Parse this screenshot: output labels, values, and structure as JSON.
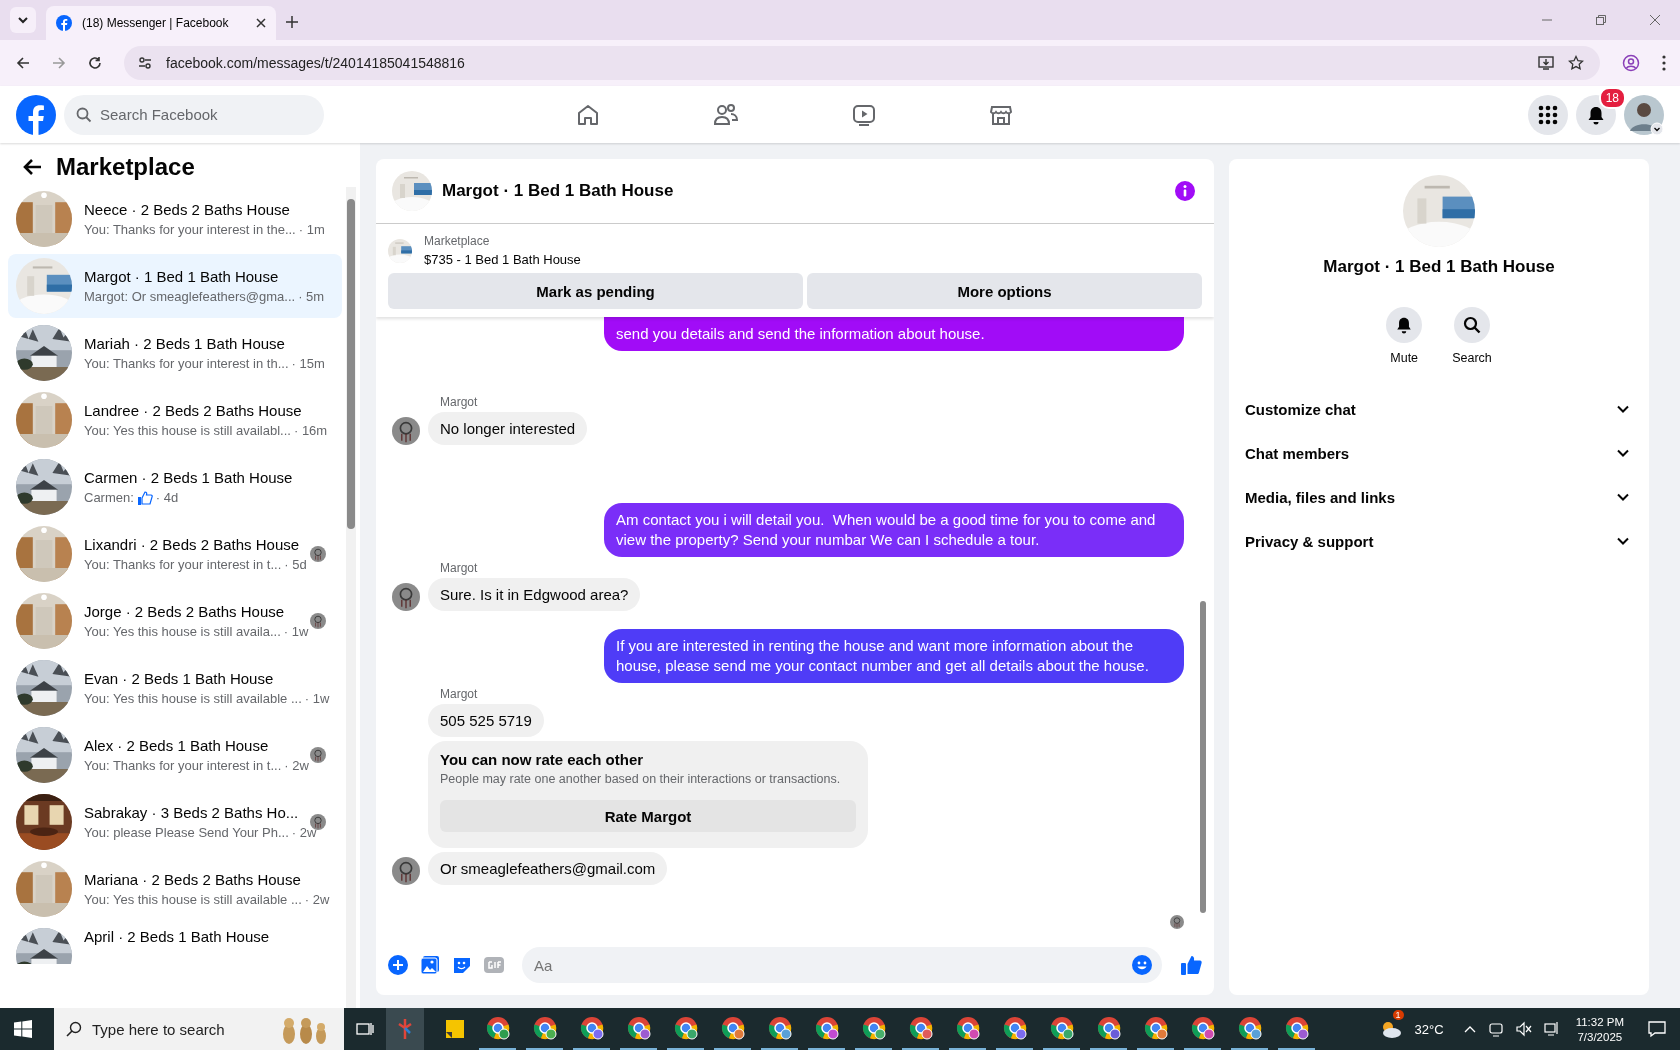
{
  "browser": {
    "tab_title": "(18) Messenger | Facebook",
    "url": "facebook.com/messages/t/24014185041548816"
  },
  "header": {
    "search_placeholder": "Search Facebook",
    "notification_count": "18"
  },
  "sidebar": {
    "title": "Marketplace",
    "items": [
      {
        "title": "Neece · 2 Beds 2 Baths House",
        "preview": "You: Thanks for your interest in the...",
        "time": "· 1m",
        "selected": false,
        "seen_avatar": false,
        "thumb": false
      },
      {
        "title": "Margot · 1 Bed 1 Bath House",
        "preview": "Margot: Or smeaglefeathers@gma...",
        "time": "· 5m",
        "selected": true,
        "seen_avatar": false,
        "thumb": false
      },
      {
        "title": "Mariah · 2 Beds 1 Bath House",
        "preview": "You: Thanks for your interest in th...",
        "time": "· 15m",
        "selected": false,
        "seen_avatar": false,
        "thumb": false
      },
      {
        "title": "Landree · 2 Beds 2 Baths House",
        "preview": "You: Yes this house is still availabl...",
        "time": "· 16m",
        "selected": false,
        "seen_avatar": false,
        "thumb": false
      },
      {
        "title": "Carmen · 2 Beds 1 Bath House",
        "preview": "Carmen:",
        "time": "· 4d",
        "selected": false,
        "seen_avatar": false,
        "thumb": true
      },
      {
        "title": "Lixandri · 2 Beds 2 Baths House",
        "preview": "You: Thanks for your interest in t...",
        "time": "· 5d",
        "selected": false,
        "seen_avatar": true,
        "thumb": false
      },
      {
        "title": "Jorge · 2 Beds 2 Baths House",
        "preview": "You: Yes this house is still availa...",
        "time": "· 1w",
        "selected": false,
        "seen_avatar": true,
        "thumb": false
      },
      {
        "title": "Evan · 2 Beds 1 Bath House",
        "preview": "You: Yes this house is still available ...",
        "time": "· 1w",
        "selected": false,
        "seen_avatar": false,
        "thumb": false
      },
      {
        "title": "Alex · 2 Beds 1 Bath House",
        "preview": "You: Thanks for your interest in t...",
        "time": "· 2w",
        "selected": false,
        "seen_avatar": true,
        "thumb": false
      },
      {
        "title": "Sabrakay · 3 Beds 2 Baths Ho...",
        "preview": "You: please Please Send Your Ph...",
        "time": "· 2w",
        "selected": false,
        "seen_avatar": true,
        "thumb": false
      },
      {
        "title": "Mariana · 2 Beds 2 Baths House",
        "preview": "You: Yes this house is still available ...",
        "time": "· 2w",
        "selected": false,
        "seen_avatar": false,
        "thumb": false
      },
      {
        "title": "April · 2 Beds 1 Bath House",
        "selected": false,
        "seen_avatar": false,
        "thumb": false
      }
    ]
  },
  "chat": {
    "title": "Margot · 1 Bed 1 Bath House",
    "listing": {
      "source": "Marketplace",
      "title": "$735 - 1 Bed 1 Bath House",
      "buttons": [
        "Mark as pending",
        "More options"
      ]
    },
    "messages": [
      {
        "kind": "outgoing",
        "text": "send you details and send the information about house.",
        "color": "#a10cf7"
      },
      {
        "kind": "incoming",
        "sender": "Margot",
        "text": "No longer interested",
        "avatar": true
      },
      {
        "kind": "outgoing",
        "text": "Am contact you i will detail you.  When would be a good time for you to come and view the property? Send your numbar We can I schedule a tour.",
        "color": "#7a2ef8"
      },
      {
        "kind": "incoming",
        "sender": "Margot",
        "text": "Sure. Is it in Edgwood area?",
        "avatar": true
      },
      {
        "kind": "outgoing",
        "text": "If you are interested in renting the house and want more information about the house, please send me your contact number and get all details about the house.",
        "color": "#4f3cf7"
      },
      {
        "kind": "incoming",
        "sender": "Margot",
        "text": "505 525 5719",
        "avatar": false
      },
      {
        "kind": "rating",
        "title": "You can now rate each other",
        "text": "People may rate one another based on their interactions or transactions.",
        "button": "Rate Margot"
      },
      {
        "kind": "incoming",
        "text": "Or smeaglefeathers@gmail.com",
        "avatar": true
      }
    ],
    "composer_placeholder": "Aa"
  },
  "details": {
    "title": "Margot · 1 Bed 1 Bath House",
    "actions": [
      {
        "kind": "mute",
        "label": "Mute"
      },
      {
        "kind": "search",
        "label": "Search"
      }
    ],
    "sections": [
      {
        "label": "Customize chat",
        "expanded": false
      },
      {
        "label": "Chat members",
        "expanded": false
      },
      {
        "label": "Media, files and links",
        "expanded": false
      },
      {
        "label": "Privacy & support",
        "expanded": false
      }
    ]
  },
  "taskbar": {
    "search_placeholder": "Type here to search",
    "weather_badge": "1",
    "temperature": "32°C",
    "time": "11:32 PM",
    "date": "7/3/2025"
  }
}
